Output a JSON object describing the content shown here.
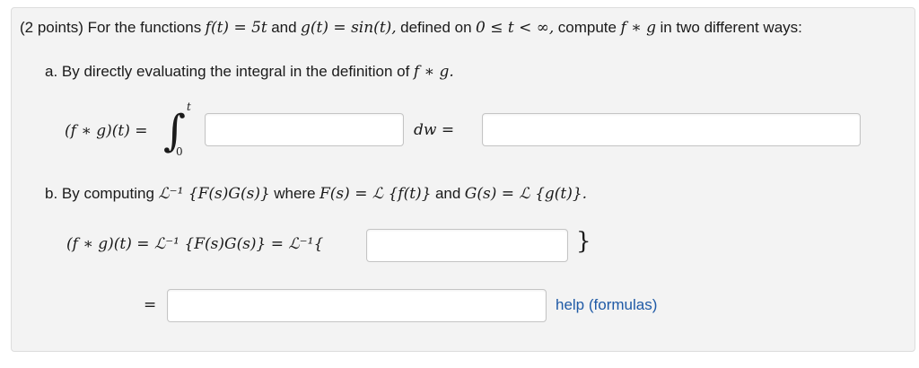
{
  "problem": {
    "intro_prefix": "(2 points) For the functions",
    "f_def": "f(t) = 5t",
    "and_word": "and",
    "g_def": "g(t) = sin(t),",
    "defined_word": "defined on",
    "domain": "0 ≤ t < ∞,",
    "compute_word": "compute",
    "conv": "f ∗ g",
    "intro_suffix": "in two different ways:"
  },
  "part_a": {
    "prefix": "a. By directly evaluating the integral in the definition of",
    "conv": "f ∗ g.",
    "lhs": "(f ∗ g)(t) =",
    "integral_sign": "∫",
    "upper_limit": "t",
    "lower_limit": "0",
    "dw": "dw =",
    "answer1_value": "",
    "answer2_value": ""
  },
  "part_b": {
    "prefix": "b. By computing",
    "laplace_inv": "ℒ⁻¹ {F(s)G(s)}",
    "where_word": "where",
    "F_def": "F(s) = ℒ {f(t)}",
    "and_word": "and",
    "G_def": "G(s) = ℒ {g(t)}.",
    "lhs": "(f ∗ g)(t) = ℒ⁻¹ {F(s)G(s)} = ℒ⁻¹{",
    "close_brace": "}",
    "equals": "=",
    "answer3_value": "",
    "answer4_value": ""
  },
  "help_link": "help (formulas)"
}
